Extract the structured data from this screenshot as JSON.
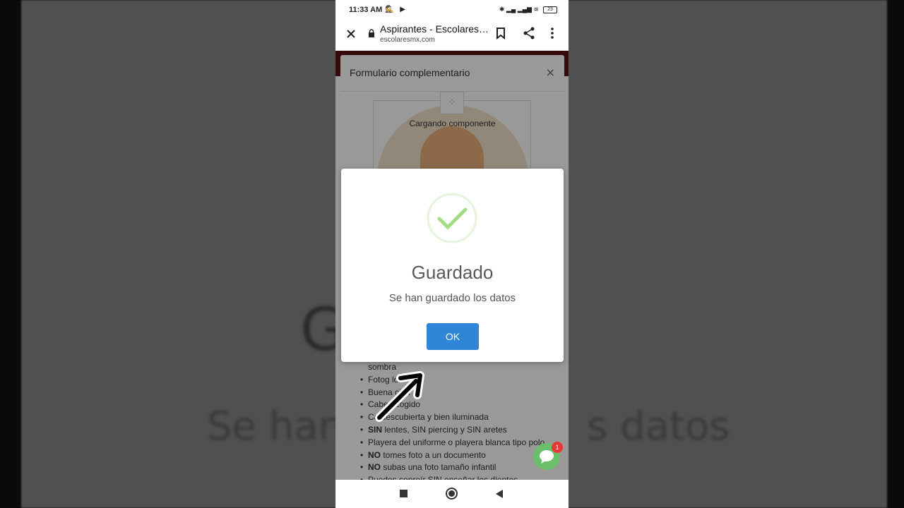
{
  "status_bar": {
    "time": "11:33 AM",
    "left_icons": "🕵 ▶",
    "right_icons": "✱ ▂▄ ▂▄▆ ≋",
    "battery": "23"
  },
  "browser": {
    "title": "Aspirantes - Escolares…",
    "domain": "escolaresmx.com",
    "icons": [
      "close-icon",
      "lock-icon",
      "bookmark-icon",
      "share-icon",
      "more-vert-icon"
    ]
  },
  "page": {
    "modal_title": "Formulario complementario",
    "modal_close": "×",
    "loading_text": "Cargando componente",
    "spinner": "⁘",
    "rules": [
      {
        "pre": "",
        "bold": "",
        "text": "sombra",
        "bullet": false
      },
      {
        "pre": "",
        "bold": "",
        "text": "Fotog      lor",
        "bullet": true
      },
      {
        "pre": "",
        "bold": "",
        "text": "Buena      ción",
        "bullet": true
      },
      {
        "pre": "",
        "bold": "",
        "text": "Cabe      ecogido",
        "bullet": true
      },
      {
        "pre": "",
        "bold": "",
        "text": "Ca    descubierta y bien iluminada",
        "bullet": true
      },
      {
        "pre": "",
        "bold": "SIN",
        "text": " lentes, SIN piercing y SIN aretes",
        "bullet": true
      },
      {
        "pre": "",
        "bold": "",
        "text": "Playera del uniforme o playera blanca tipo polo",
        "bullet": true
      },
      {
        "pre": "",
        "bold": "NO",
        "text": " tomes foto a un documento",
        "bullet": true
      },
      {
        "pre": "",
        "bold": "NO",
        "text": " subas una foto tamaño infantil",
        "bullet": true
      },
      {
        "pre": "",
        "bold": "",
        "text": "Puedes sonreír SIN enseñar los dientes",
        "bullet": true
      }
    ]
  },
  "alert": {
    "title": "Guardado",
    "text": "Se han guardado los datos",
    "ok_label": "OK",
    "icon": "success-check-icon",
    "accent_color": "#3085d6",
    "success_color": "#a5dc86"
  },
  "chat": {
    "badge": "1"
  },
  "background": {
    "big_title": "G           o",
    "big_sub_left": "Se han",
    "big_sub_right": "s datos"
  }
}
